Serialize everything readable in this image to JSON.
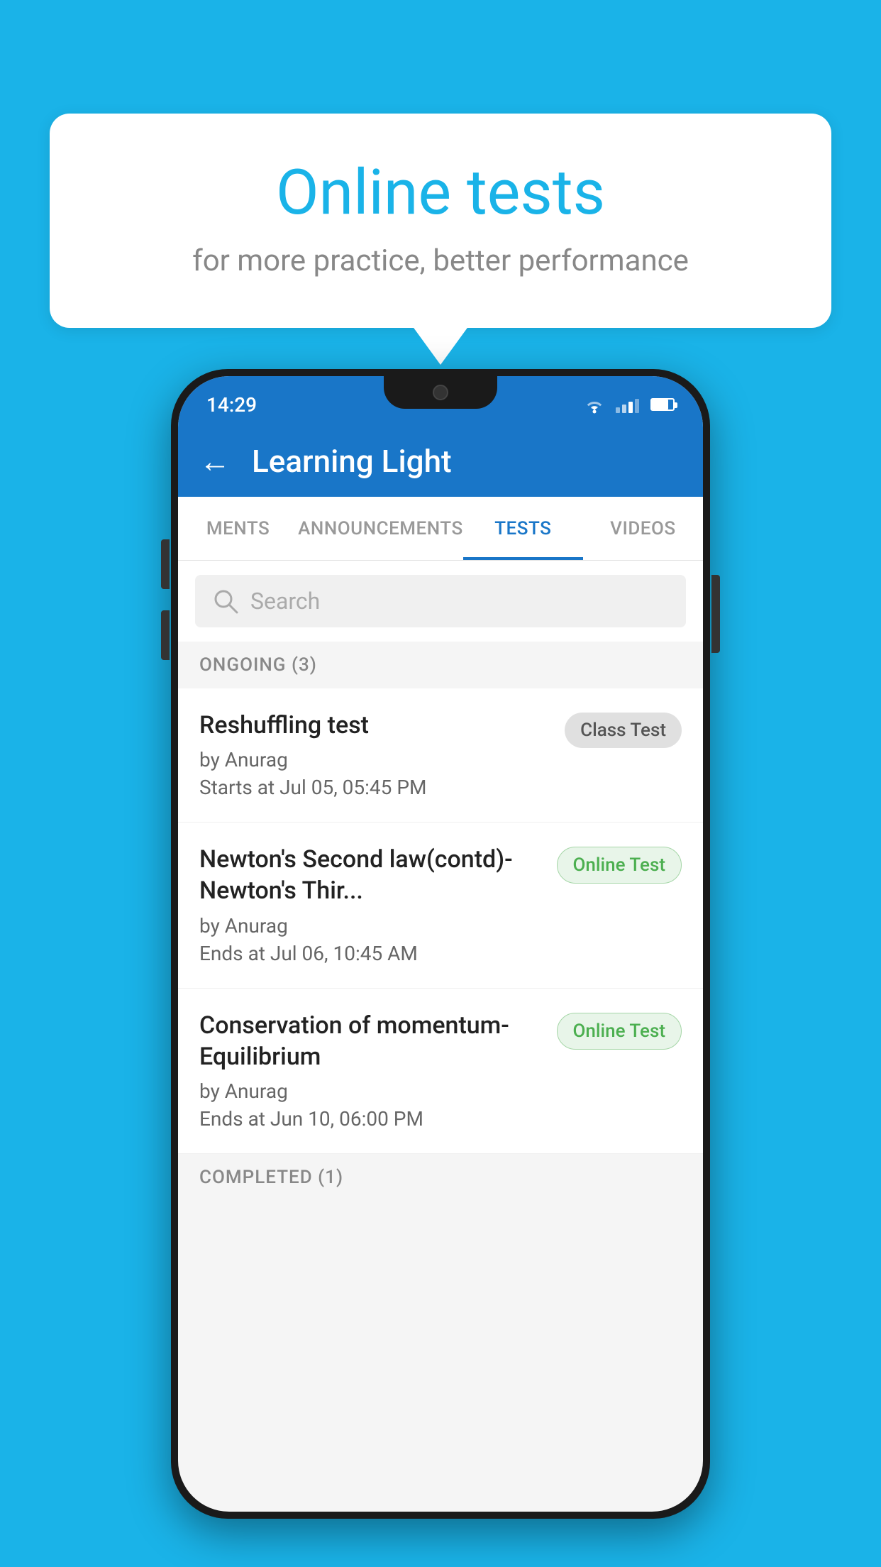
{
  "background": {
    "color": "#1ab3e8"
  },
  "speech_bubble": {
    "title": "Online tests",
    "subtitle": "for more practice, better performance"
  },
  "phone": {
    "status_bar": {
      "time": "14:29"
    },
    "app_bar": {
      "title": "Learning Light",
      "back_label": "←"
    },
    "tabs": [
      {
        "label": "MENTS",
        "active": false
      },
      {
        "label": "ANNOUNCEMENTS",
        "active": false
      },
      {
        "label": "TESTS",
        "active": true
      },
      {
        "label": "VIDEOS",
        "active": false
      }
    ],
    "search": {
      "placeholder": "Search"
    },
    "sections": [
      {
        "label": "ONGOING (3)",
        "tests": [
          {
            "title": "Reshuffling test",
            "author": "by Anurag",
            "date": "Starts at  Jul 05, 05:45 PM",
            "badge": "Class Test",
            "badge_type": "class"
          },
          {
            "title": "Newton's Second law(contd)-Newton's Thir...",
            "author": "by Anurag",
            "date": "Ends at  Jul 06, 10:45 AM",
            "badge": "Online Test",
            "badge_type": "online"
          },
          {
            "title": "Conservation of momentum-Equilibrium",
            "author": "by Anurag",
            "date": "Ends at  Jun 10, 06:00 PM",
            "badge": "Online Test",
            "badge_type": "online"
          }
        ]
      }
    ],
    "completed_section": {
      "label": "COMPLETED (1)"
    }
  }
}
